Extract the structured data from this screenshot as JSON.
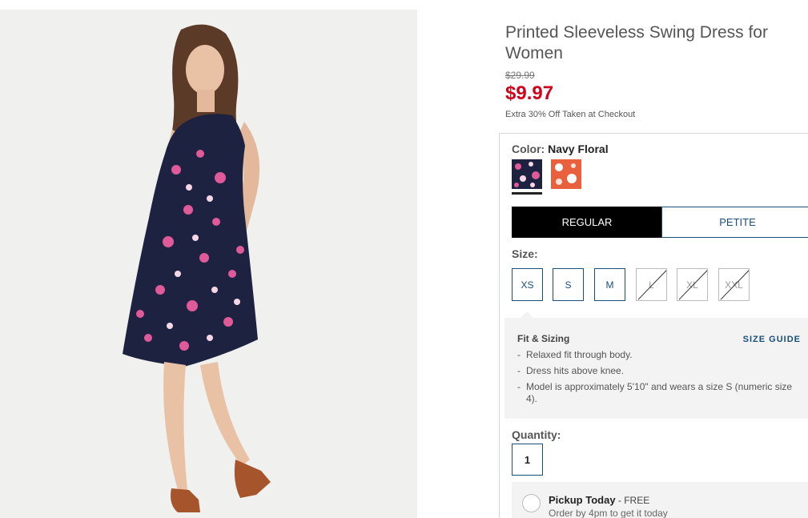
{
  "product": {
    "title": "Printed Sleeveless Swing Dress for Women",
    "original_price": "$29.99",
    "sale_price": "$9.97",
    "promo_text": "Extra 30% Off Taken at Checkout",
    "image_icon": "model-photo"
  },
  "color": {
    "label": "Color:",
    "selected": "Navy Floral",
    "swatches": [
      {
        "name": "navy-floral",
        "base": "#1d2240",
        "accent": "#e05a9a"
      },
      {
        "name": "coral-floral",
        "base": "#e8603c",
        "accent": "#ffffff"
      }
    ]
  },
  "fit_options": {
    "regular": "REGULAR",
    "petite": "PETITE",
    "selected": "REGULAR"
  },
  "size": {
    "label": "Size:",
    "options": [
      {
        "label": "XS",
        "available": true
      },
      {
        "label": "S",
        "available": true
      },
      {
        "label": "M",
        "available": true
      },
      {
        "label": "L",
        "available": false
      },
      {
        "label": "XL",
        "available": false
      },
      {
        "label": "XXL",
        "available": false
      }
    ]
  },
  "fit_sizing": {
    "title": "Fit & Sizing",
    "guide_link": "SIZE GUIDE",
    "bullets": [
      "Relaxed fit through body.",
      "Dress hits above knee.",
      "Model is approximately 5'10\" and wears a size S (numeric size 4)."
    ]
  },
  "quantity": {
    "label": "Quantity:",
    "value": "1"
  },
  "pickup": {
    "title": "Pickup Today",
    "price_note": " - FREE",
    "subtitle": "Order by 4pm to get it today"
  },
  "colors": {
    "price_red": "#d0021b",
    "link_blue": "#1a4f7a",
    "dress_navy": "#1d2240"
  }
}
